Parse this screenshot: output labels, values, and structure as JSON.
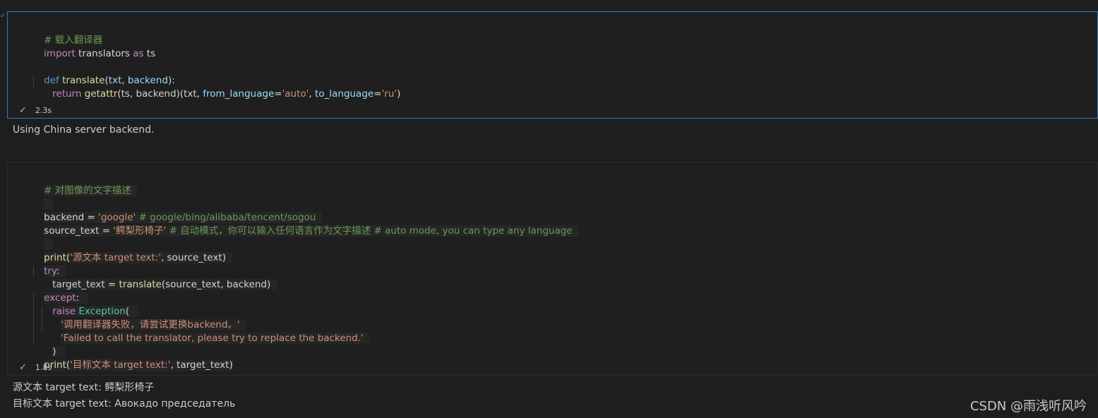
{
  "cell1": {
    "code": {
      "comment": "# 载入翻译器",
      "import_kw": "import",
      "import_mod": " translators ",
      "as_kw": "as",
      "alias": " ts",
      "def_kw": "def",
      "func_name": "translate",
      "paren_open": "(",
      "param1": "txt",
      "comma1": ", ",
      "param2": "backend",
      "paren_close": "):",
      "return_kw": "return",
      "getattr": "getattr",
      "args1": "(ts, backend)(txt, ",
      "from_lang": "from_language",
      "eq1": "=",
      "auto_str": "'auto'",
      "comma2": ", ",
      "to_lang": "to_language",
      "eq2": "=",
      "ru_str": "'ru'",
      "close": ")"
    },
    "status": {
      "time": "2.3s"
    },
    "output": "Using China server backend."
  },
  "cell2": {
    "code": {
      "comment1": "# 对图像的文字描述",
      "backend_var": "backend = ",
      "google_str": "'google'",
      "backend_cmt": " # google/bing/alibaba/tencent/sogou",
      "source_var": "source_text = ",
      "source_str": "'鳄梨形椅子'",
      "source_cmt": " # 自动模式，你可以输入任何语言作为文字描述 # auto mode, you can type any language",
      "print1_fn": "print",
      "print1_open": "(",
      "print1_str": "'源文本 target text:'",
      "print1_rest": ", source_text)",
      "try_kw": "try",
      "try_colon": ":",
      "target_line": "target_text = ",
      "translate_fn": "translate",
      "translate_args": "(source_text, backend)",
      "except_kw": "except",
      "except_colon": ":",
      "raise_kw": "raise",
      "exception_cls": "Exception",
      "exception_open": "(",
      "msg_cn": "'调用翻译器失败，请尝试更换backend。'",
      "msg_en": "'Failed to call the translator, please try to replace the backend.'",
      "close_paren": ")",
      "print2_fn": "print",
      "print2_open": "(",
      "print2_str": "'目标文本 target text:'",
      "print2_rest": ", target_text)"
    },
    "status": {
      "time": "1.8s"
    },
    "output_lines": [
      "源文本 target text: 鳄梨形椅子",
      "目标文本 target text: Авокадо председатель"
    ]
  },
  "watermark": "CSDN @雨浅听风吟",
  "colors": {
    "keyword": "#c586c0",
    "keyword_blue": "#569cd6",
    "function": "#dcdcaa",
    "string": "#ce9178",
    "comment": "#6a9955",
    "class": "#4ec9b0",
    "focus_border": "#2a7ac9",
    "success": "#89d185"
  }
}
